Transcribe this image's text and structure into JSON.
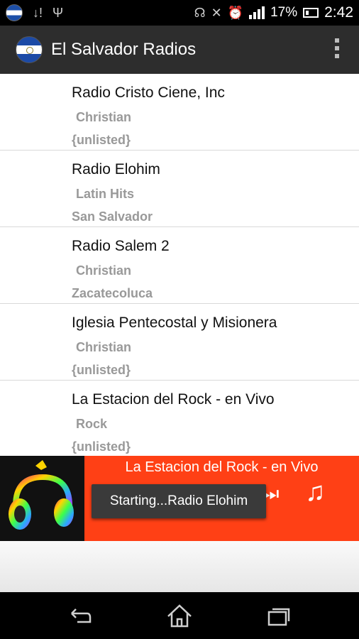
{
  "status_bar": {
    "battery_percent": "17%",
    "time": "2:42",
    "icons": [
      "flag-icon",
      "download-alert-icon",
      "usb-icon",
      "headset-icon",
      "bluetooth-icon",
      "alarm-icon",
      "signal-icon",
      "battery-charging-icon"
    ]
  },
  "app": {
    "title": "El Salvador Radios",
    "logo": "el-salvador-flag-icon",
    "menu_icon": "overflow-menu-icon"
  },
  "stations": [
    {
      "name": "Radio Cristo Ciene, Inc",
      "genre": "Christian",
      "city": "{unlisted}"
    },
    {
      "name": "Radio Elohim",
      "genre": "Latin Hits",
      "city": "San Salvador"
    },
    {
      "name": "Radio Salem 2",
      "genre": "Christian",
      "city": "Zacatecoluca"
    },
    {
      "name": "Iglesia Pentecostal y Misionera",
      "genre": "Christian",
      "city": "{unlisted}"
    },
    {
      "name": "La Estacion del Rock - en Vivo",
      "genre": "Rock",
      "city": "{unlisted}"
    }
  ],
  "player": {
    "now_playing": "La Estacion del Rock - en Vivo",
    "toast": "Starting...Radio Elohim",
    "accent_color": "#ff4015",
    "controls": [
      "previous-icon",
      "pause-icon",
      "stop-icon",
      "next-icon",
      "music-note-icon"
    ]
  },
  "nav_bar": {
    "buttons": [
      "back-icon",
      "home-icon",
      "recent-apps-icon"
    ]
  }
}
